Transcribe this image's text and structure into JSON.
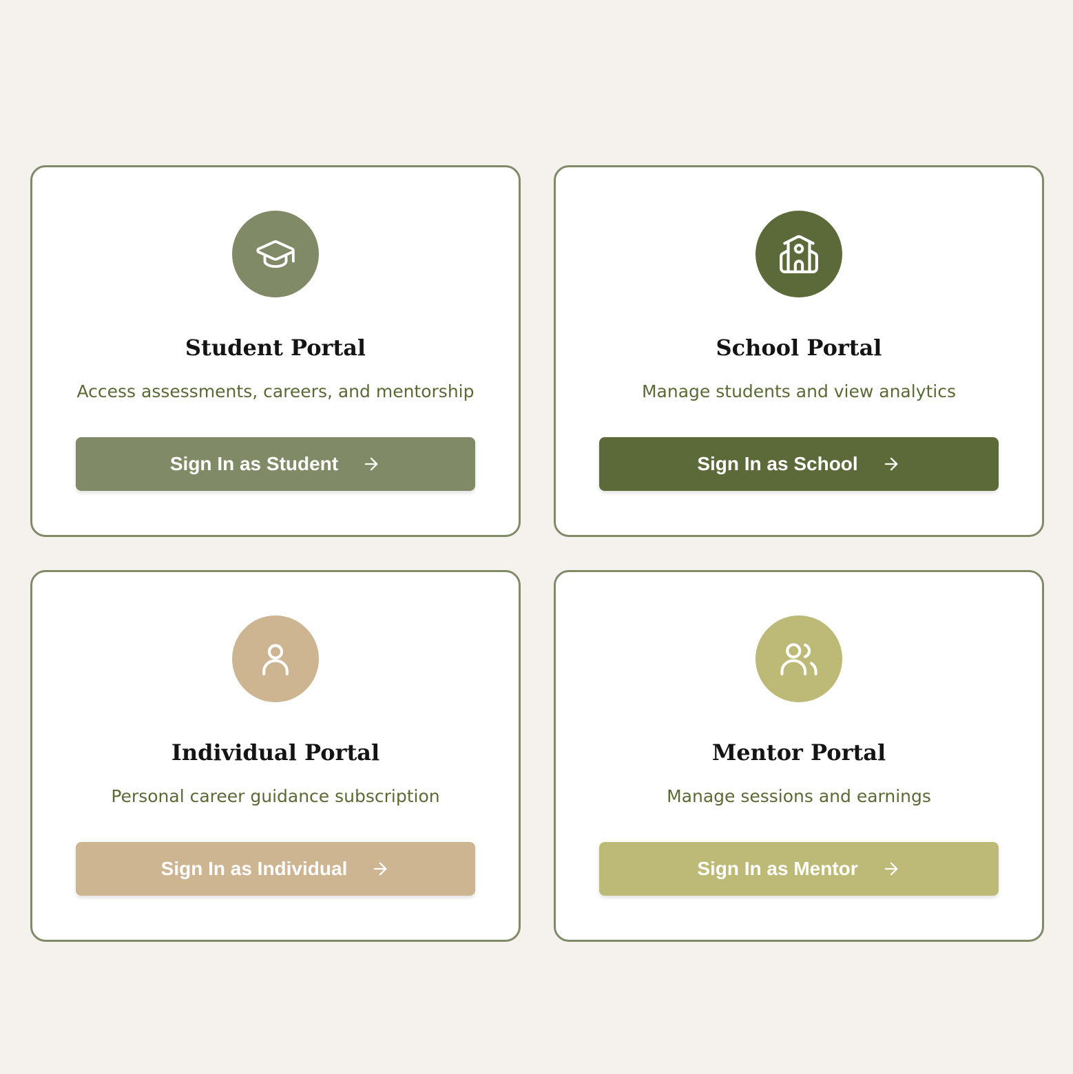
{
  "colors": {
    "page_bg": "#f5f2ee",
    "card_border": "#808a67",
    "title": "#141414",
    "description": "#5a6a35"
  },
  "portals": [
    {
      "id": "student",
      "icon": "graduation-cap-icon",
      "color": "#808a67",
      "title": "Student Portal",
      "description": "Access assessments, careers, and mentorship",
      "button_label": "Sign In as Student"
    },
    {
      "id": "school",
      "icon": "school-building-icon",
      "color": "#5b6a38",
      "title": "School Portal",
      "description": "Manage students and view analytics",
      "button_label": "Sign In as School"
    },
    {
      "id": "individual",
      "icon": "user-icon",
      "color": "#cdb592",
      "title": "Individual Portal",
      "description": "Personal career guidance subscription",
      "button_label": "Sign In as Individual"
    },
    {
      "id": "mentor",
      "icon": "users-icon",
      "color": "#bdb976",
      "title": "Mentor Portal",
      "description": "Manage sessions and earnings",
      "button_label": "Sign In as Mentor"
    }
  ]
}
